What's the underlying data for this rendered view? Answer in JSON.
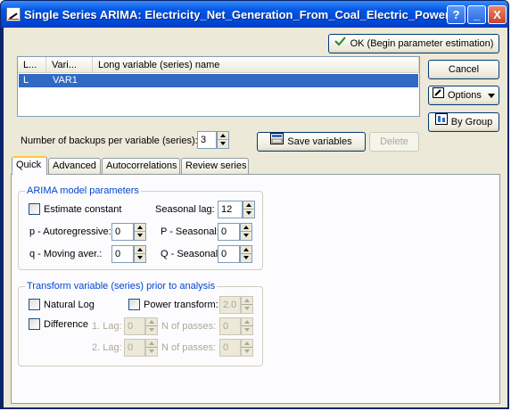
{
  "window": {
    "title": "Single Series ARIMA: Electricity_Net_Generation_From_Coal_Electric_Power",
    "help_btn": "?",
    "min_btn": "_",
    "close_btn": "X"
  },
  "buttons": {
    "ok": "OK (Begin parameter estimation)",
    "cancel": "Cancel",
    "options": "Options",
    "by_group": "By Group",
    "save_variables": "Save variables",
    "delete": "Delete"
  },
  "variables_list": {
    "columns": [
      "L...",
      "Vari...",
      "Long variable (series) name"
    ],
    "rows": [
      {
        "l": "L",
        "var": "VAR1",
        "long_name": ""
      }
    ]
  },
  "backups": {
    "label": "Number of backups per variable (series):",
    "value": "3"
  },
  "tabs": [
    "Quick",
    "Advanced",
    "Autocorrelations",
    "Review series"
  ],
  "arima": {
    "title": "ARIMA model parameters",
    "estimate_constant": "Estimate constant",
    "seasonal_lag_label": "Seasonal lag:",
    "seasonal_lag": "12",
    "p_label": "p - Autoregressive:",
    "p": "0",
    "P_label": "P - Seasonal:",
    "P": "0",
    "q_label": "q - Moving aver.:",
    "q": "0",
    "Q_label": "Q - Seasonal:",
    "Q": "0"
  },
  "transform": {
    "title": "Transform variable (series) prior to analysis",
    "natural_log": "Natural Log",
    "power_transform": "Power transform:",
    "power_value": "2.0",
    "difference": "Difference",
    "lag1_label": "1. Lag:",
    "lag1": "0",
    "passes1_label": "N of passes:",
    "passes1": "0",
    "lag2_label": "2. Lag:",
    "lag2": "0",
    "passes2_label": "N of passes:",
    "passes2": "0"
  },
  "colors": {
    "titlebar": "#0055e5",
    "selection": "#316ac5",
    "group_title": "#0046d5",
    "active_tab_accent": "#ffc83c"
  }
}
